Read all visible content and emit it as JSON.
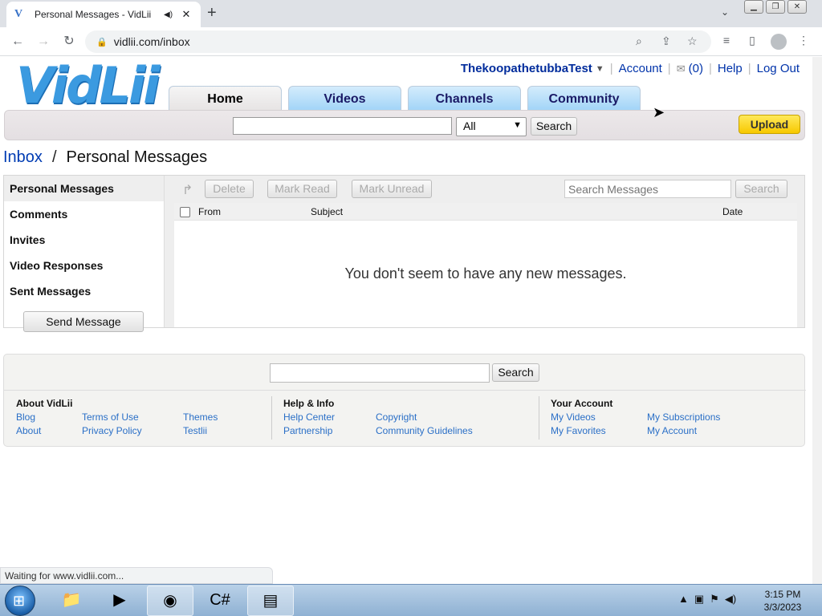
{
  "browser": {
    "tab_title": "Personal Messages - VidLii",
    "tab_favicon": "V",
    "tab_close": "✕",
    "new_tab": "+",
    "url": "vidlii.com/inbox",
    "window_buttons": [
      "▁",
      "❐",
      "✕"
    ],
    "status_text": "Waiting for www.vidlii.com..."
  },
  "site": {
    "logo_text": "VidLii",
    "username": "ThekoopathetubbaTest",
    "user_nav": {
      "account": "Account",
      "inbox_count": "(0)",
      "help": "Help",
      "logout": "Log Out"
    },
    "tabs": [
      "Home",
      "Videos",
      "Channels",
      "Community"
    ],
    "active_tab": "Home",
    "search": {
      "value": "",
      "filter_value": "All",
      "button": "Search"
    },
    "upload": "Upload"
  },
  "breadcrumb": {
    "root": "Inbox",
    "separator": "/",
    "current": "Personal Messages"
  },
  "sidebar": {
    "items": [
      "Personal Messages",
      "Comments",
      "Invites",
      "Video Responses",
      "Sent Messages"
    ],
    "active": "Personal Messages",
    "send_button": "Send Message"
  },
  "inbox": {
    "actions": {
      "delete": "Delete",
      "mark_read": "Mark Read",
      "mark_unread": "Mark Unread"
    },
    "search_placeholder": "Search Messages",
    "search_button": "Search",
    "columns": {
      "from": "From",
      "subject": "Subject",
      "date": "Date"
    },
    "empty_message": "You don't seem to have any new messages."
  },
  "footer": {
    "search_button": "Search",
    "columns": [
      {
        "title": "About VidLii",
        "links": [
          "Blog",
          "Terms of Use",
          "Themes",
          "About",
          "Privacy Policy",
          "Testlii"
        ]
      },
      {
        "title": "Help & Info",
        "links": [
          "Help Center",
          "Copyright",
          "Partnership",
          "Community Guidelines"
        ]
      },
      {
        "title": "Your Account",
        "links": [
          "My Videos",
          "My Subscriptions",
          "My Favorites",
          "My Account"
        ]
      }
    ]
  },
  "taskbar": {
    "time": "3:15 PM",
    "date": "3/3/2023"
  },
  "colors": {
    "link_blue": "#0033aa",
    "tab_blue": "#9fd3f7",
    "upload_yellow": "#f7c800",
    "footer_link": "#2a6fc7"
  }
}
